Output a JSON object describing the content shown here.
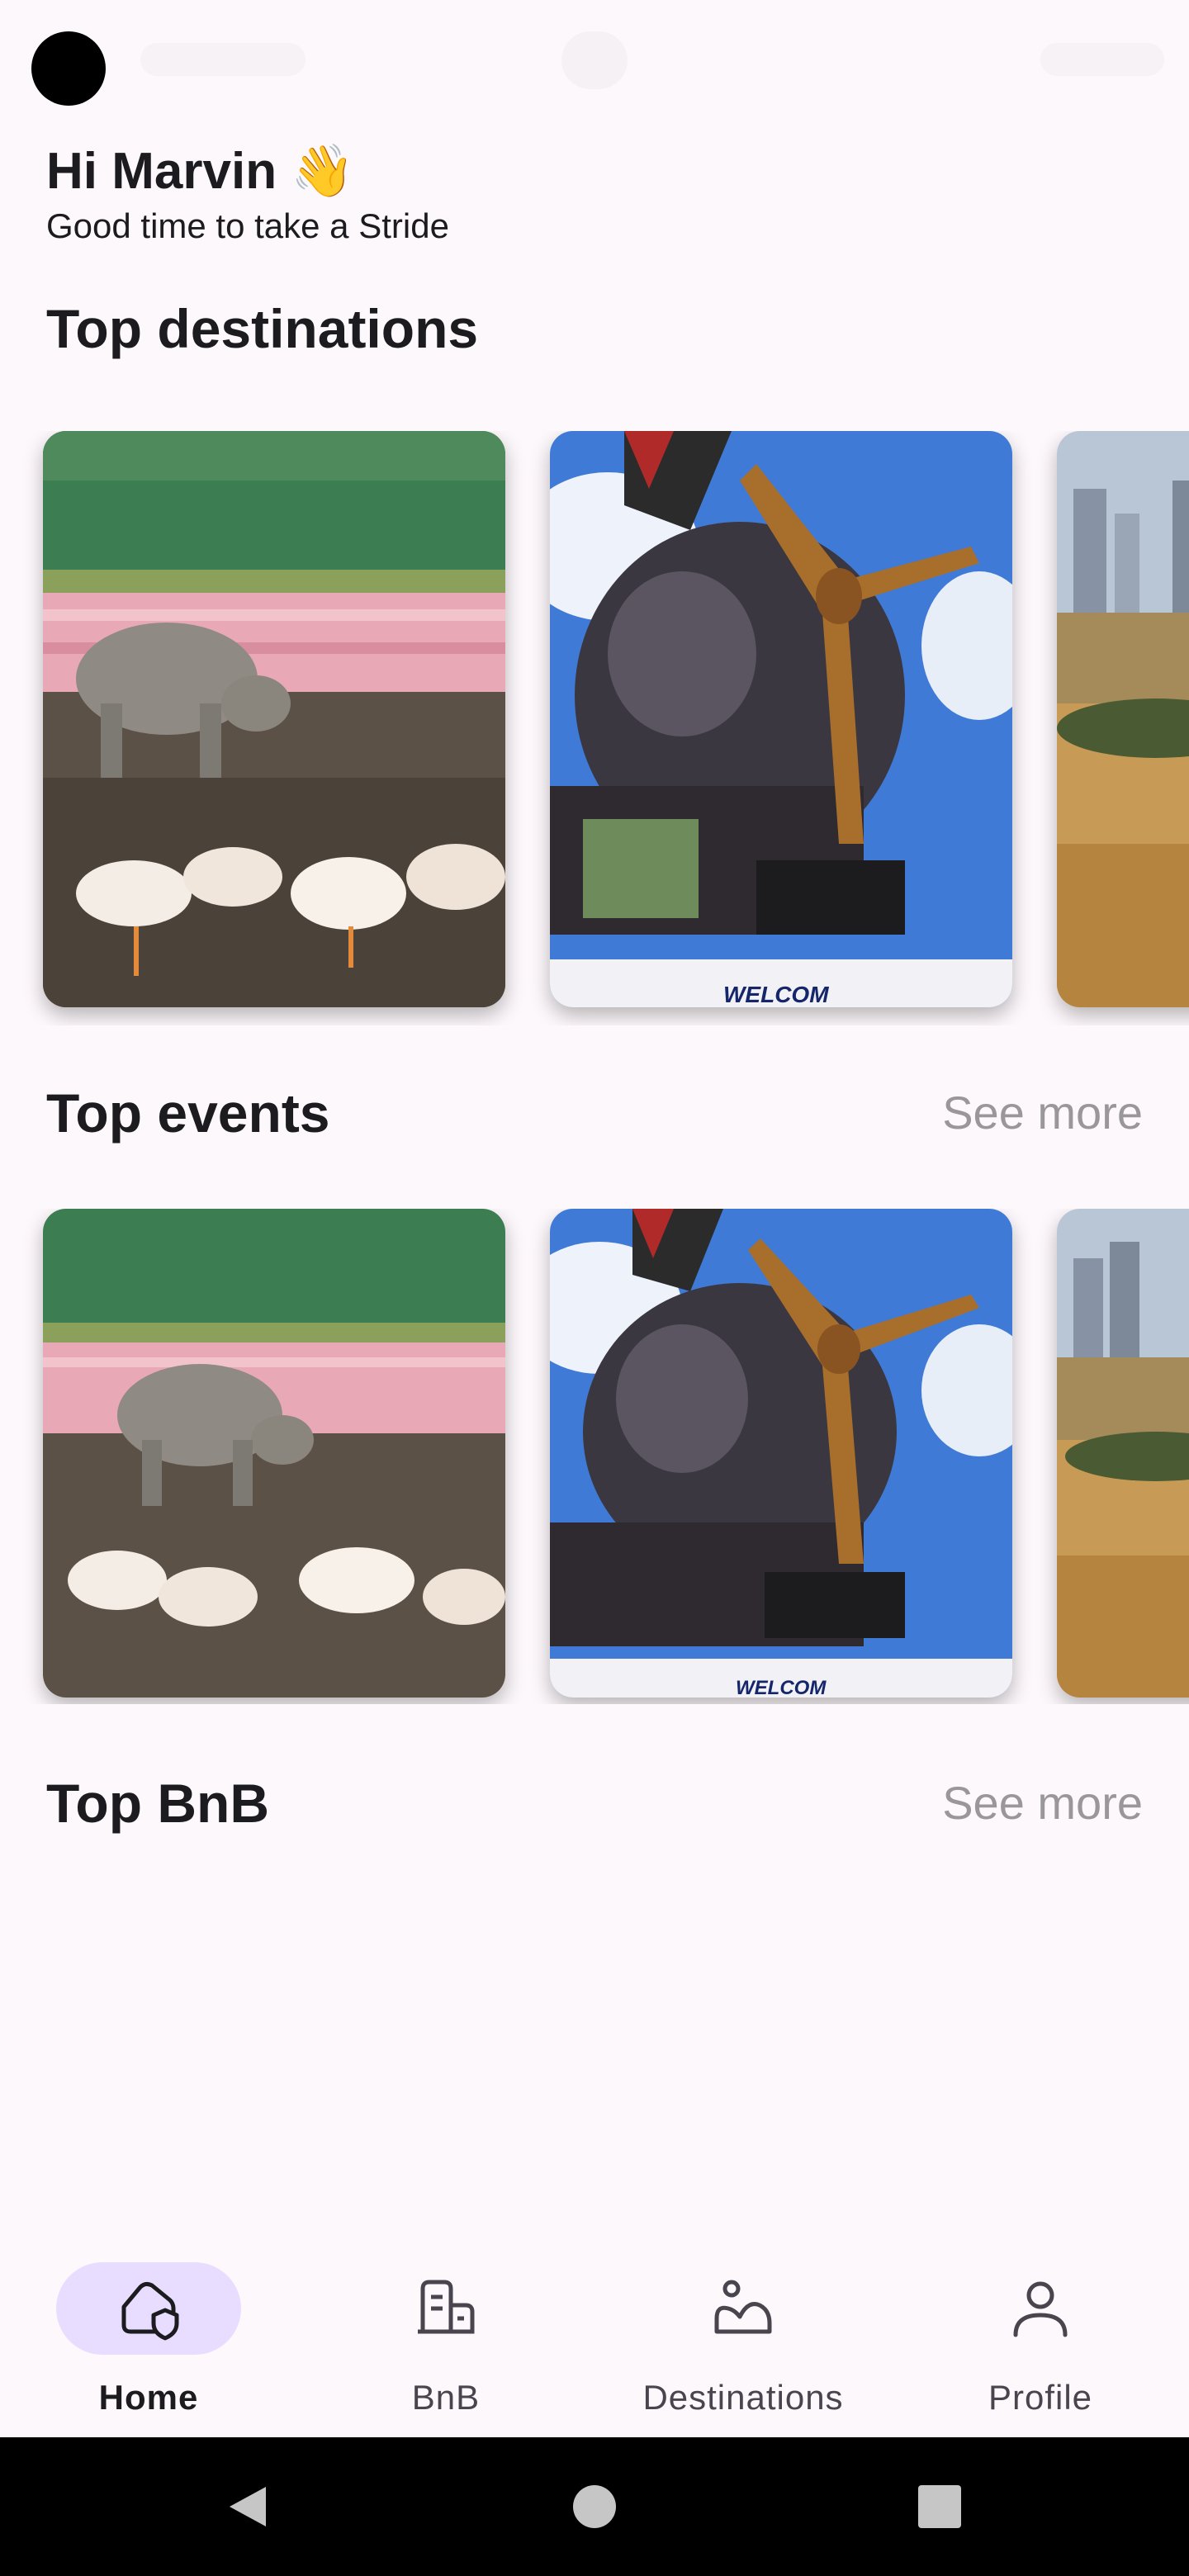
{
  "greeting": {
    "title": "Hi Marvin 👋",
    "subtitle": "Good time to take a Stride"
  },
  "sections": {
    "destinations": {
      "title": "Top destinations"
    },
    "events": {
      "title": "Top events",
      "see_more": "See more"
    },
    "bnb": {
      "title": "Top BnB",
      "see_more": "See more"
    }
  },
  "nav": {
    "items": [
      {
        "label": "Home",
        "icon": "home-icon",
        "active": true
      },
      {
        "label": "BnB",
        "icon": "building-icon",
        "active": false
      },
      {
        "label": "Destinations",
        "icon": "landscape-icon",
        "active": false
      },
      {
        "label": "Profile",
        "icon": "person-icon",
        "active": false
      }
    ]
  },
  "colors": {
    "background": "#fdf8fc",
    "active_pill": "#e9ddff",
    "see_more": "#9a979b"
  }
}
